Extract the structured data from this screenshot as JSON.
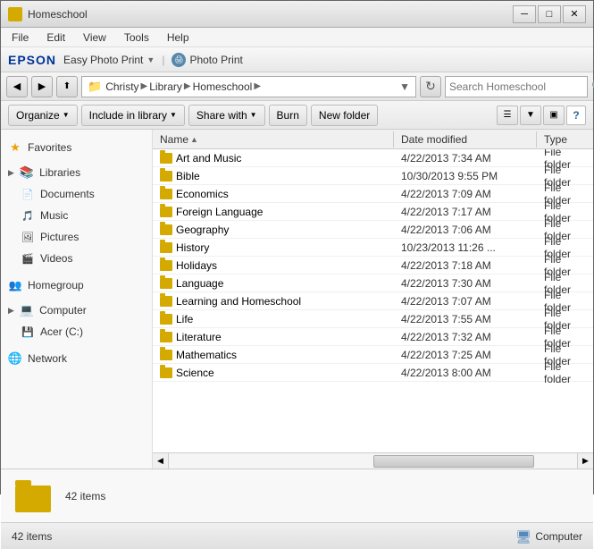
{
  "titleBar": {
    "title": "Homeschool",
    "controls": [
      "minimize",
      "maximize",
      "close"
    ],
    "minimizeLabel": "─",
    "maximizeLabel": "□",
    "closeLabel": "✕"
  },
  "menuBar": {
    "items": [
      "File",
      "Edit",
      "View",
      "Tools",
      "Help"
    ]
  },
  "epsonBar": {
    "brand": "EPSON",
    "appName": "Easy Photo Print",
    "dropdownIcon": "▼",
    "separator": "|",
    "photoPrint": "Photo Print"
  },
  "navBar": {
    "backLabel": "◀",
    "forwardLabel": "▶",
    "upLabel": "▲",
    "pathParts": [
      "Christy",
      "Library",
      "Homeschool"
    ],
    "dropdownLabel": "▼",
    "refreshLabel": "↻",
    "searchPlaceholder": "Search Homeschool",
    "searchIcon": "🔍"
  },
  "actionBar": {
    "organize": "Organize",
    "includeInLibrary": "Include in library",
    "shareWith": "Share with",
    "burn": "Burn",
    "newFolder": "New folder",
    "dropArrow": "▼",
    "helpLabel": "?"
  },
  "sidebar": {
    "favorites": {
      "label": "Favorites",
      "icon": "★"
    },
    "libraries": {
      "label": "Libraries",
      "items": [
        {
          "label": "Documents",
          "icon": "📄"
        },
        {
          "label": "Music",
          "icon": "♪"
        },
        {
          "label": "Pictures",
          "icon": "🖼"
        },
        {
          "label": "Videos",
          "icon": "🎬"
        }
      ]
    },
    "homegroup": {
      "label": "Homegroup",
      "icon": "👥"
    },
    "computer": {
      "label": "Computer",
      "icon": "💻"
    },
    "acer": {
      "label": "Acer (C:)",
      "icon": "💾"
    },
    "network": {
      "label": "Network",
      "icon": "🌐"
    }
  },
  "fileList": {
    "columns": {
      "name": "Name",
      "dateModified": "Date modified",
      "type": "Type"
    },
    "rows": [
      {
        "name": "Art and Music",
        "date": "4/22/2013 7:34 AM",
        "type": "File folder"
      },
      {
        "name": "Bible",
        "date": "10/30/2013 9:55 PM",
        "type": "File folder"
      },
      {
        "name": "Economics",
        "date": "4/22/2013 7:09 AM",
        "type": "File folder"
      },
      {
        "name": "Foreign Language",
        "date": "4/22/2013 7:17 AM",
        "type": "File folder"
      },
      {
        "name": "Geography",
        "date": "4/22/2013 7:06 AM",
        "type": "File folder"
      },
      {
        "name": "History",
        "date": "10/23/2013 11:26 ...",
        "type": "File folder"
      },
      {
        "name": "Holidays",
        "date": "4/22/2013 7:18 AM",
        "type": "File folder"
      },
      {
        "name": "Language",
        "date": "4/22/2013 7:30 AM",
        "type": "File folder"
      },
      {
        "name": "Learning and Homeschool",
        "date": "4/22/2013 7:07 AM",
        "type": "File folder"
      },
      {
        "name": "Life",
        "date": "4/22/2013 7:55 AM",
        "type": "File folder"
      },
      {
        "name": "Literature",
        "date": "4/22/2013 7:32 AM",
        "type": "File folder"
      },
      {
        "name": "Mathematics",
        "date": "4/22/2013 7:25 AM",
        "type": "File folder"
      },
      {
        "name": "Science",
        "date": "4/22/2013 8:00 AM",
        "type": "File folder"
      }
    ]
  },
  "bottomPanel": {
    "itemCount": "42 items"
  },
  "statusBar": {
    "itemCount": "42 items",
    "computerLabel": "Computer"
  }
}
